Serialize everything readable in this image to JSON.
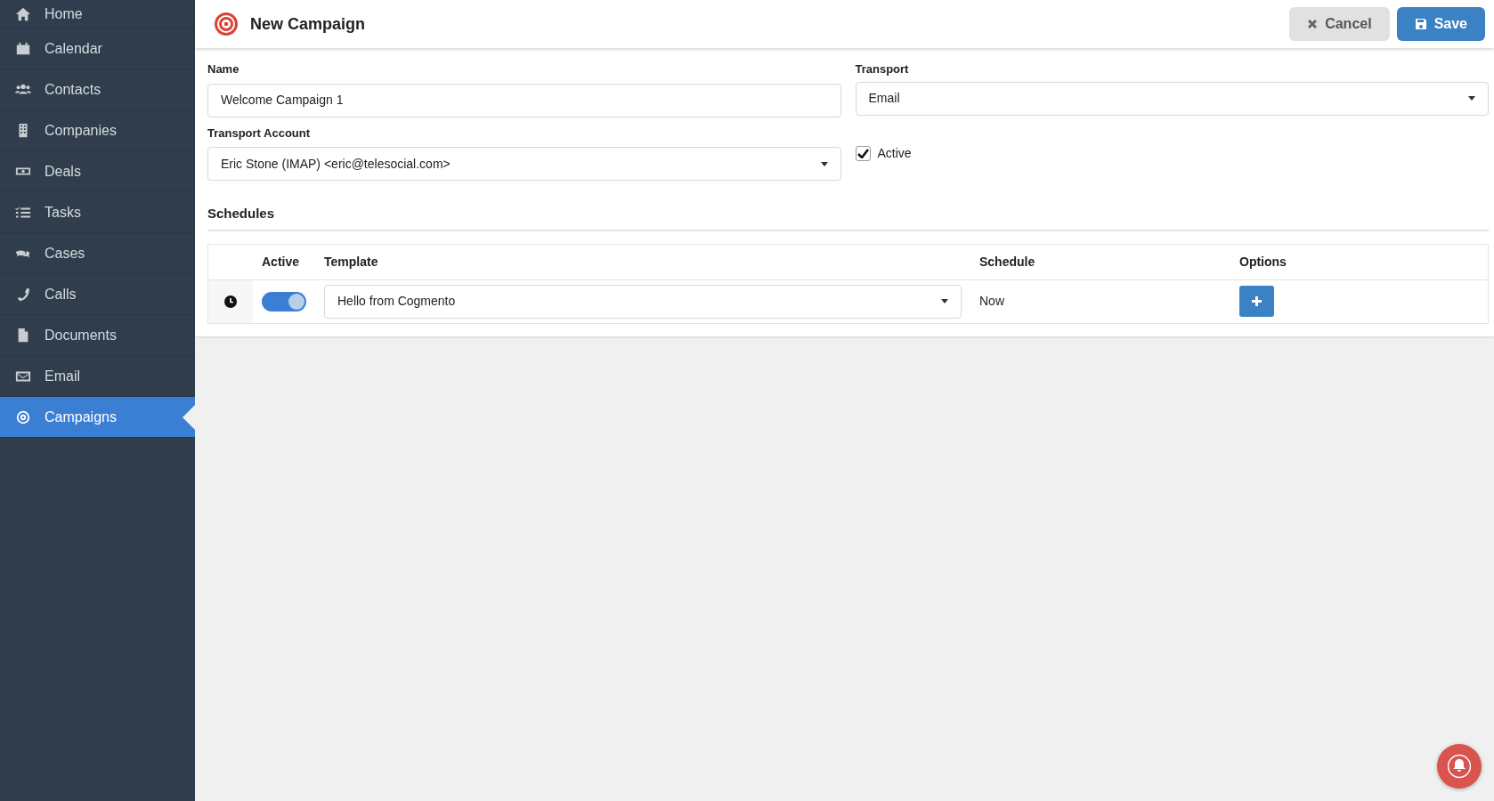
{
  "sidebar": {
    "items": [
      {
        "label": "Home",
        "selected": false
      },
      {
        "label": "Calendar",
        "selected": false
      },
      {
        "label": "Contacts",
        "selected": false
      },
      {
        "label": "Companies",
        "selected": false
      },
      {
        "label": "Deals",
        "selected": false
      },
      {
        "label": "Tasks",
        "selected": false
      },
      {
        "label": "Cases",
        "selected": false
      },
      {
        "label": "Calls",
        "selected": false
      },
      {
        "label": "Documents",
        "selected": false
      },
      {
        "label": "Email",
        "selected": false
      },
      {
        "label": "Campaigns",
        "selected": true
      }
    ]
  },
  "header": {
    "title": "New Campaign",
    "buttons": [
      {
        "kind": "cancel",
        "label": "Cancel"
      },
      {
        "kind": "save",
        "label": "Save"
      }
    ]
  },
  "form": {
    "name": {
      "label": "Name",
      "value": "Welcome Campaign 1"
    },
    "transport": {
      "label": "Transport",
      "value": "Email"
    },
    "transport_account": {
      "label": "Transport Account",
      "value": "Eric Stone (IMAP) <eric@telesocial.com>"
    },
    "active": {
      "label": "Active",
      "checked": true
    }
  },
  "schedules": {
    "title": "Schedules",
    "columns": [
      "Active",
      "Template",
      "Schedule",
      "Options"
    ],
    "rows": [
      {
        "on": true,
        "template": "Hello from Cogmento",
        "schedule": "Now"
      }
    ]
  }
}
